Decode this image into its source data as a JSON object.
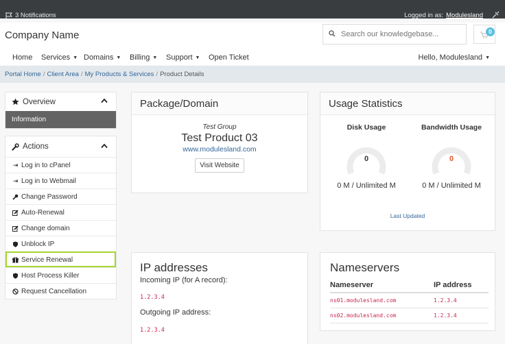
{
  "topbar": {
    "notifications": "3 Notifications",
    "logged_in_label": "Logged in as:",
    "username": "Modulesland"
  },
  "header": {
    "company_name": "Company Name",
    "search_placeholder": "Search our knowledgebase...",
    "cart_count": "0"
  },
  "nav": {
    "items": [
      "Home",
      "Services",
      "Domains",
      "Billing",
      "Support",
      "Open Ticket"
    ],
    "user_menu": "Hello, Modulesland"
  },
  "breadcrumb": [
    "Portal Home",
    "Client Area",
    "My Products & Services",
    "Product Details"
  ],
  "sidebar": {
    "overview_title": "Overview",
    "overview_active": "Information",
    "actions_title": "Actions",
    "actions": [
      {
        "label": "Log in to cPanel",
        "icon": "sign-in-icon"
      },
      {
        "label": "Log in to Webmail",
        "icon": "sign-in-icon"
      },
      {
        "label": "Change Password",
        "icon": "key-icon"
      },
      {
        "label": "Auto-Renewal",
        "icon": "edit-icon"
      },
      {
        "label": "Change domain",
        "icon": "edit-icon"
      },
      {
        "label": "Unblock IP",
        "icon": "shield-icon"
      },
      {
        "label": "Service Renewal",
        "icon": "gift-icon"
      },
      {
        "label": "Host Process Killer",
        "icon": "shield-icon"
      },
      {
        "label": "Request Cancellation",
        "icon": "ban-icon"
      }
    ]
  },
  "package": {
    "title": "Package/Domain",
    "group": "Test Group",
    "product": "Test Product 03",
    "domain": "www.modulesland.com",
    "visit_button": "Visit Website"
  },
  "usage": {
    "title": "Usage Statistics",
    "disk_title": "Disk Usage",
    "disk_value": "0",
    "disk_text": "0 M / Unlimited M",
    "bandwidth_title": "Bandwidth Usage",
    "bandwidth_value": "0",
    "bandwidth_text": "0 M / Unlimited M",
    "last_updated": "Last Updated"
  },
  "ip": {
    "title": "IP addresses",
    "incoming_label": "Incoming IP (for A record):",
    "incoming_value": "1.2.3.4",
    "outgoing_label": "Outgoing IP address:",
    "outgoing_value": "1.2.3.4"
  },
  "nameservers": {
    "title": "Nameservers",
    "col_ns": "Nameserver",
    "col_ip": "IP address",
    "rows": [
      {
        "ns": "ns01.modulesland.com",
        "ip": "1.2.3.4"
      },
      {
        "ns": "ns02.modulesland.com",
        "ip": "1.2.3.4"
      }
    ]
  },
  "colors": {
    "topbar": "#3a3d40",
    "accent_link": "#336699",
    "highlight_outline": "#a5d62e",
    "code_red": "#c7254e",
    "badge": "#5bc0de"
  }
}
